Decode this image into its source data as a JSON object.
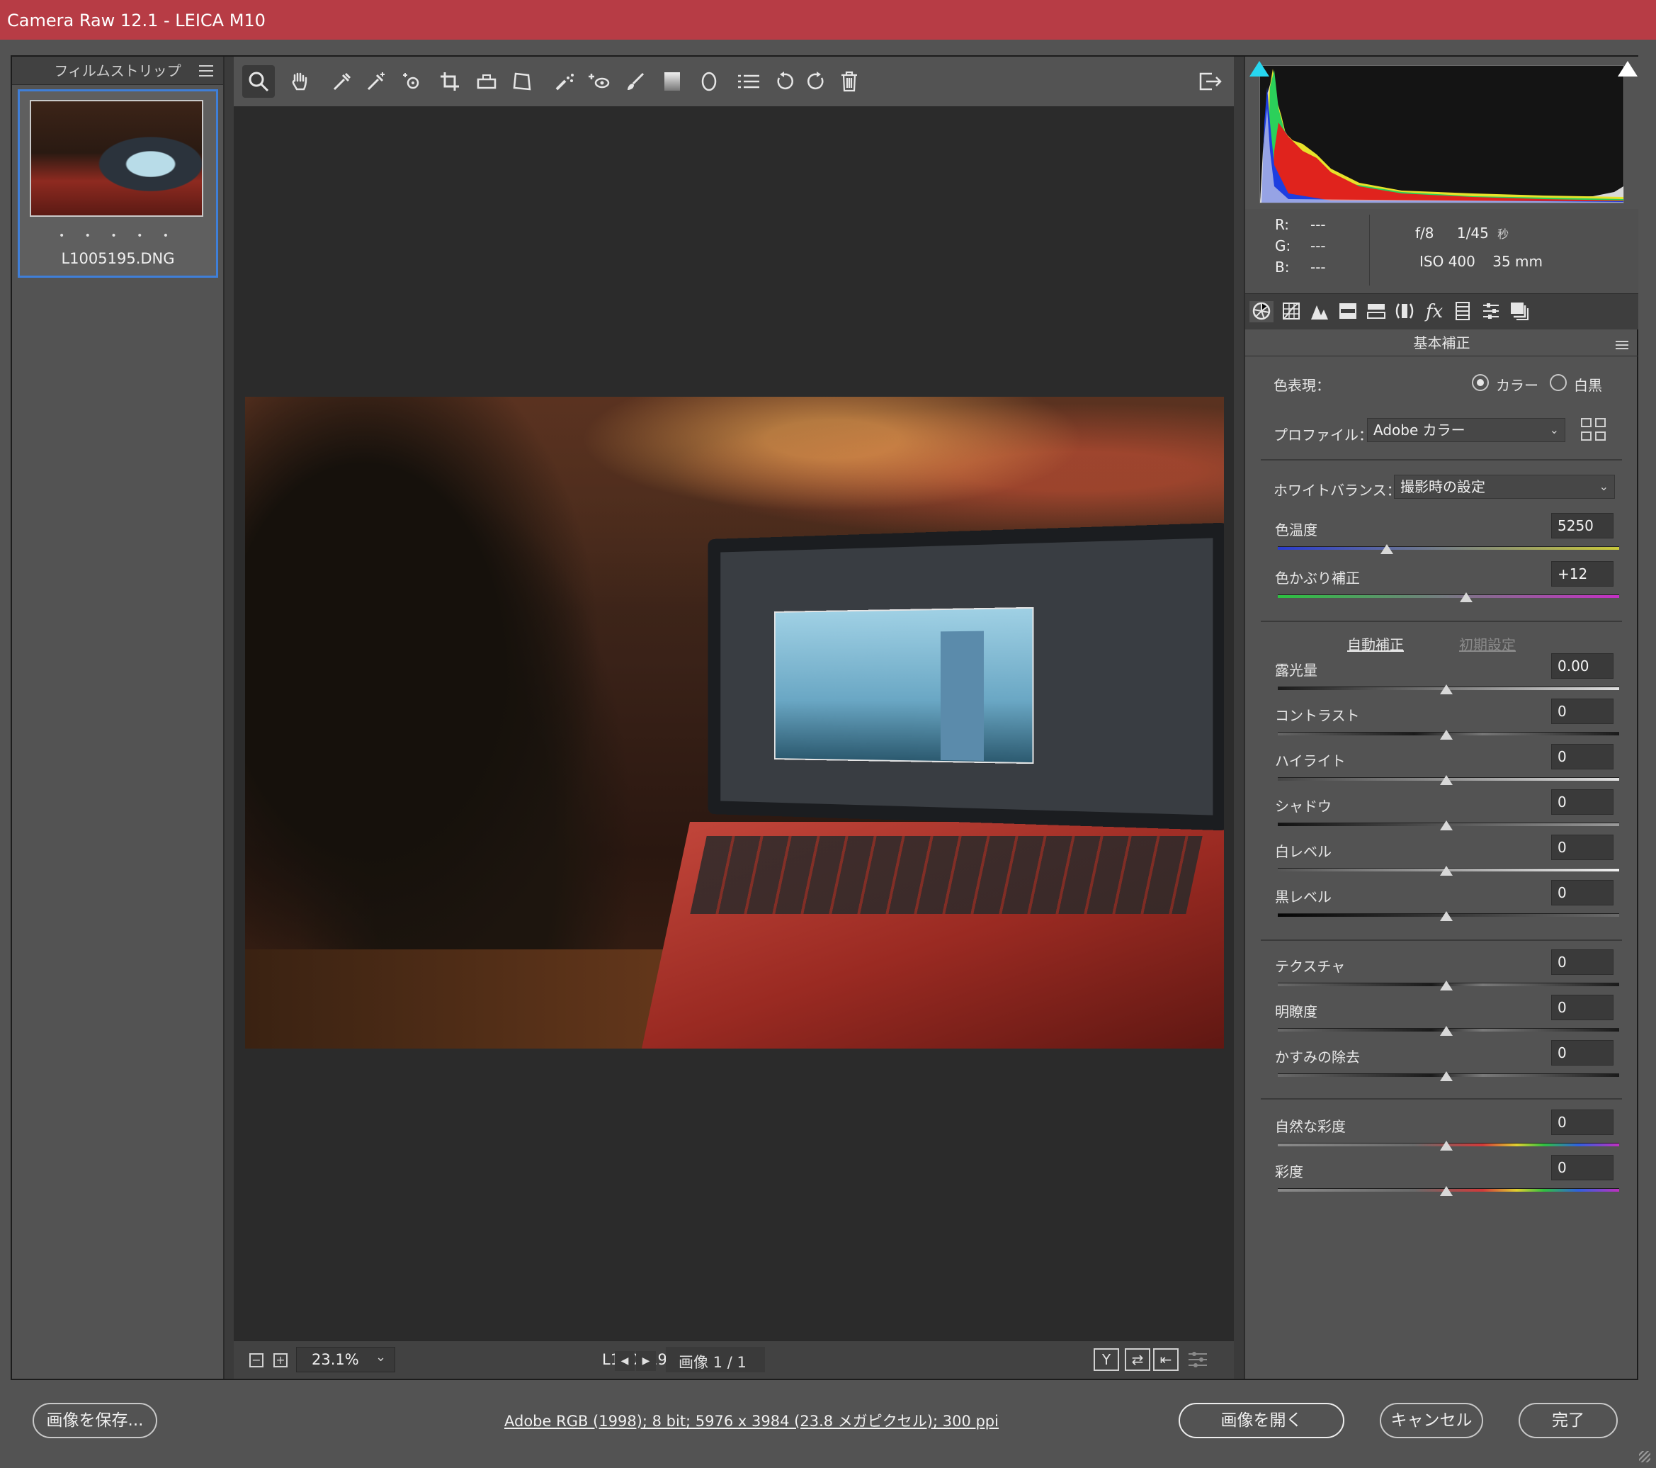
{
  "window": {
    "title": "Camera Raw 12.1  -  LEICA M10"
  },
  "filmstrip": {
    "header": "フィルムストリップ",
    "thumb_dots": "• • • • •",
    "file_name": "L1005195.DNG"
  },
  "toolbar": {
    "tools": [
      "zoom-icon",
      "hand-icon",
      "white-balance-icon",
      "color-sampler-icon",
      "targeted-adjustment-icon",
      "crop-icon",
      "straighten-icon",
      "transform-icon",
      "spot-removal-icon",
      "red-eye-icon",
      "adjustment-brush-icon",
      "graduated-filter-icon",
      "radial-filter-icon",
      "presets-list-icon",
      "rotate-left-icon",
      "rotate-right-icon",
      "trash-icon"
    ],
    "export_icon": "export-icon"
  },
  "status": {
    "zoom": "23.1%",
    "file_name": "L1005195.DNG",
    "image_counter": "画像 1 / 1"
  },
  "histogram": {
    "r_label": "R:",
    "r_value": "---",
    "g_label": "G:",
    "g_value": "---",
    "b_label": "B:",
    "b_value": "---",
    "aperture": "f/8",
    "shutter": "1/45",
    "shutter_unit": "秒",
    "iso": "ISO 400",
    "focal": "35 mm"
  },
  "panel": {
    "title": "基本補正",
    "treatment_label": "色表現：",
    "color_option": "カラー",
    "bw_option": "白黒",
    "profile_label": "プロファイル：",
    "profile_value": "Adobe カラー",
    "wb_label": "ホワイトバランス：",
    "wb_value": "撮影時の設定",
    "temp_label": "色温度",
    "temp_value": "5250",
    "tint_label": "色かぶり補正",
    "tint_value": "+12",
    "auto_link": "自動補正",
    "default_link": "初期設定",
    "exposure_label": "露光量",
    "exposure_value": "0.00",
    "contrast_label": "コントラスト",
    "contrast_value": "0",
    "highlights_label": "ハイライト",
    "highlights_value": "0",
    "shadows_label": "シャドウ",
    "shadows_value": "0",
    "whites_label": "白レベル",
    "whites_value": "0",
    "blacks_label": "黒レベル",
    "blacks_value": "0",
    "texture_label": "テクスチャ",
    "texture_value": "0",
    "clarity_label": "明瞭度",
    "clarity_value": "0",
    "dehaze_label": "かすみの除去",
    "dehaze_value": "0",
    "vibrance_label": "自然な彩度",
    "vibrance_value": "0",
    "saturation_label": "彩度",
    "saturation_value": "0"
  },
  "bottom": {
    "save_button": "画像を保存...",
    "workflow_info": "Adobe RGB (1998); 8 bit; 5976 x 3984 (23.8 メガピクセル); 300 ppi",
    "open_button": "画像を開く",
    "cancel_button": "キャンセル",
    "done_button": "完了"
  },
  "colors": {
    "titlebar": "#b73c45",
    "accent": "#3f7fd8",
    "panel_bg": "#535353",
    "canvas_bg": "#2b2b2b"
  }
}
